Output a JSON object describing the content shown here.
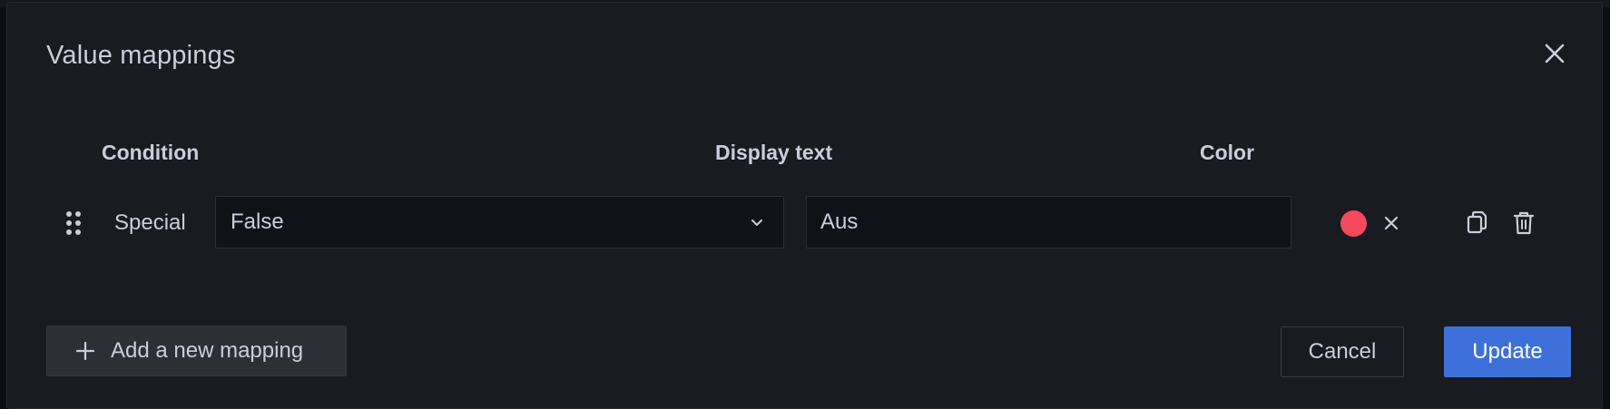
{
  "modal": {
    "title": "Value mappings",
    "close_icon": "close-icon"
  },
  "columns": {
    "condition": "Condition",
    "display_text": "Display text",
    "color": "Color"
  },
  "mappings": [
    {
      "type_label": "Special",
      "condition_value": "False",
      "display_text": "Aus",
      "color": "#f2495c"
    }
  ],
  "footer": {
    "add_label": "Add a new mapping",
    "cancel_label": "Cancel",
    "update_label": "Update"
  },
  "colors": {
    "accent": "#3d71d9",
    "modal_bg": "#181b1f",
    "text": "#ccccdc"
  },
  "icons": {
    "drag": "drag-handle-icon",
    "chevron": "chevron-down-icon",
    "clear": "clear-color-icon",
    "duplicate": "copy-icon",
    "delete": "trash-icon",
    "add": "plus-icon"
  }
}
